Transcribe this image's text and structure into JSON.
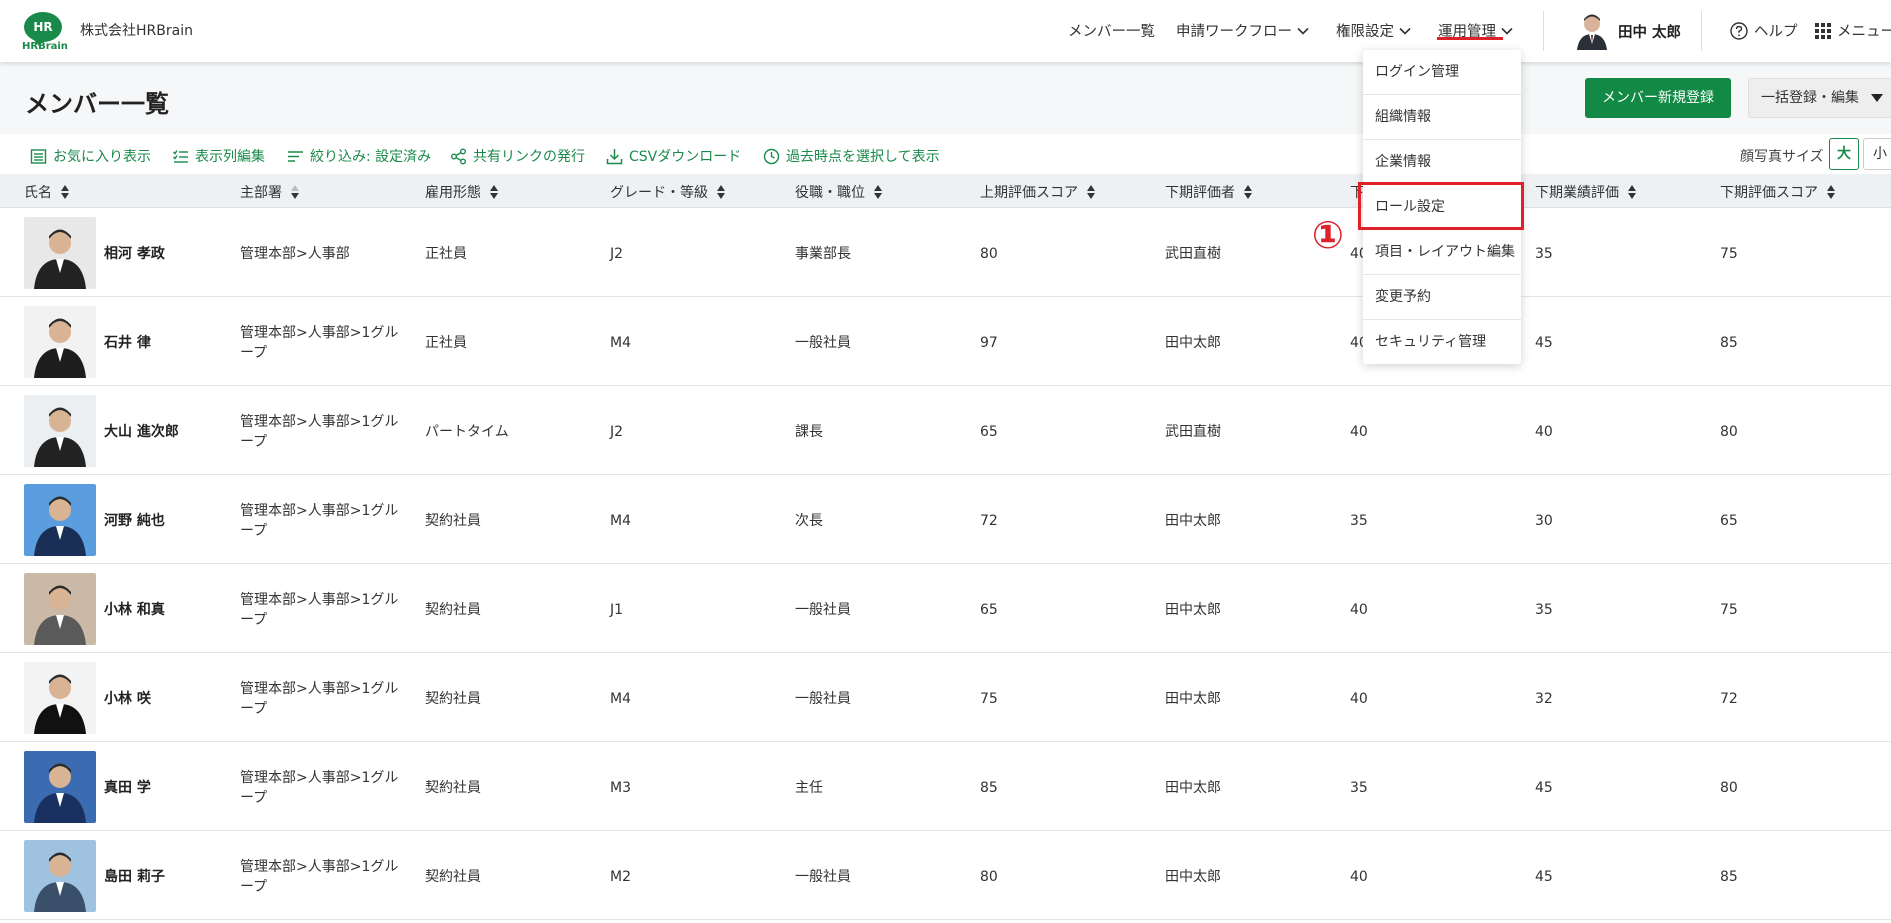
{
  "header": {
    "logo_text": "HR",
    "logo_brand": "HRBrain",
    "company_name": "株式会社HRBrain",
    "nav": {
      "members": "メンバー一覧",
      "workflow": "申請ワークフロー",
      "permissions": "権限設定",
      "operations": "運用管理"
    },
    "user_name": "田中 太郎",
    "help": "ヘルプ",
    "menu": "メニュー"
  },
  "title_bar": {
    "title": "メンバー一覧",
    "new_member_button": "メンバー新規登録",
    "bulk_button": "一括登録・編集"
  },
  "toolbar": {
    "favorites": "お気に入り表示",
    "columns": "表示列編集",
    "filter": "絞り込み: 設定済み",
    "share": "共有リンクの発行",
    "csv": "CSVダウンロード",
    "past": "過去時点を選択して表示",
    "photo_size_label": "顔写真サイズ",
    "size_large": "大",
    "size_small": "小"
  },
  "table": {
    "columns": [
      "氏名",
      "主部署",
      "雇用形態",
      "グレード・等級",
      "役職・職位",
      "上期評価スコア",
      "下期評価者",
      "下期目標評価",
      "下期業績評価",
      "下期評価スコア"
    ],
    "visible_col8_header": "下",
    "rows": [
      {
        "name": "相河 孝政",
        "dept": "管理本部>人事部",
        "employment": "正社員",
        "grade": "J2",
        "position": "事業部長",
        "h1_score": "80",
        "h2_evaluator": "武田直樹",
        "h2_goal": "40",
        "h2_perf": "35",
        "h2_score": "75"
      },
      {
        "name": "石井 律",
        "dept": "管理本部>人事部>1グループ",
        "employment": "正社員",
        "grade": "M4",
        "position": "一般社員",
        "h1_score": "97",
        "h2_evaluator": "田中太郎",
        "h2_goal": "40",
        "h2_perf": "45",
        "h2_score": "85"
      },
      {
        "name": "大山 進次郎",
        "dept": "管理本部>人事部>1グループ",
        "employment": "パートタイム",
        "grade": "J2",
        "position": "課長",
        "h1_score": "65",
        "h2_evaluator": "武田直樹",
        "h2_goal": "40",
        "h2_perf": "40",
        "h2_score": "80"
      },
      {
        "name": "河野 純也",
        "dept": "管理本部>人事部>1グループ",
        "employment": "契約社員",
        "grade": "M4",
        "position": "次長",
        "h1_score": "72",
        "h2_evaluator": "田中太郎",
        "h2_goal": "35",
        "h2_perf": "30",
        "h2_score": "65"
      },
      {
        "name": "小林 和真",
        "dept": "管理本部>人事部>1グループ",
        "employment": "契約社員",
        "grade": "J1",
        "position": "一般社員",
        "h1_score": "65",
        "h2_evaluator": "田中太郎",
        "h2_goal": "40",
        "h2_perf": "35",
        "h2_score": "75"
      },
      {
        "name": "小林 咲",
        "dept": "管理本部>人事部>1グループ",
        "employment": "契約社員",
        "grade": "M4",
        "position": "一般社員",
        "h1_score": "75",
        "h2_evaluator": "田中太郎",
        "h2_goal": "40",
        "h2_perf": "32",
        "h2_score": "72"
      },
      {
        "name": "真田 学",
        "dept": "管理本部>人事部>1グループ",
        "employment": "契約社員",
        "grade": "M3",
        "position": "主任",
        "h1_score": "85",
        "h2_evaluator": "田中太郎",
        "h2_goal": "35",
        "h2_perf": "45",
        "h2_score": "80"
      },
      {
        "name": "島田 莉子",
        "dept": "管理本部>人事部>1グループ",
        "employment": "契約社員",
        "grade": "M2",
        "position": "一般社員",
        "h1_score": "80",
        "h2_evaluator": "田中太郎",
        "h2_goal": "40",
        "h2_perf": "45",
        "h2_score": "85"
      }
    ]
  },
  "dropdown": {
    "items": [
      "ログイン管理",
      "組織情報",
      "企業情報",
      "ロール設定",
      "項目・レイアウト編集",
      "変更予約",
      "セキュリティ管理"
    ],
    "highlighted_index": 3,
    "step_marker": "①"
  },
  "colors": {
    "brand_green": "#1a8a4a",
    "primary_button": "#128a45",
    "highlight_red": "#e0202a"
  }
}
